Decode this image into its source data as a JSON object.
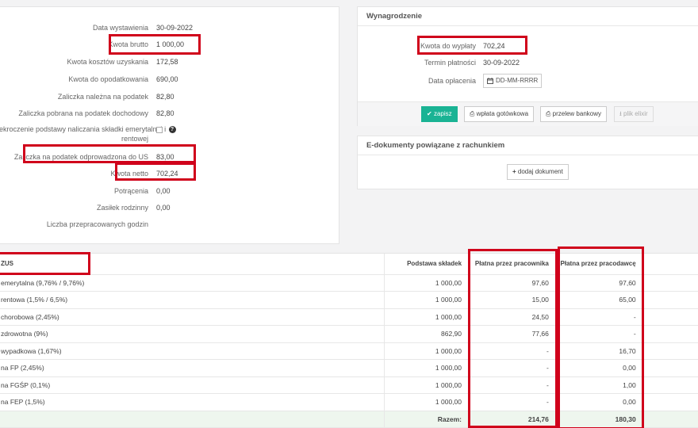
{
  "details": {
    "rows": [
      {
        "label": "Data wystawienia",
        "value": "30-09-2022"
      },
      {
        "label": "Kwota brutto",
        "value": "1 000,00"
      },
      {
        "label": "Kwota kosztów uzyskania",
        "value": "172,58"
      },
      {
        "label": "Kwota do opodatkowania",
        "value": "690,00"
      },
      {
        "label": "Zaliczka należna na podatek",
        "value": "82,80"
      },
      {
        "label": "Zaliczka pobrana na podatek dochodowy",
        "value": "82,80"
      },
      {
        "label": "Zaliczka na podatek odprowadzona do US",
        "value": "83,00"
      },
      {
        "label": "Kwota netto",
        "value": "702,24"
      },
      {
        "label": "Potrącenia",
        "value": "0,00"
      },
      {
        "label": "Zasiłek rodzinny",
        "value": "0,00"
      },
      {
        "label": "Liczba przepracowanych godzin",
        "value": ""
      }
    ],
    "exceed_label_line1": "ekroczenie podstawy naliczania składki emerytalnej i",
    "exceed_label_line2": "rentowej",
    "exceed_help": "?"
  },
  "salary": {
    "title": "Wynagrodzenie",
    "amount_label": "Kwota do wypłaty",
    "amount_value": "702,24",
    "due_label": "Termin płatności",
    "due_value": "30-09-2022",
    "paid_label": "Data opłacenia",
    "paid_placeholder": "DD-MM-RRRR",
    "buttons": {
      "save": "zapisz",
      "cash": "wpłata gotówkowa",
      "transfer": "przelew bankowy",
      "elixir": "plik elixir"
    }
  },
  "edocs": {
    "title": "E-dokumenty powiązane z rachunkiem",
    "add_button": "dodaj dokument"
  },
  "zus": {
    "headers": {
      "name": "ZUS",
      "base": "Podstawa składek",
      "employee": "Płatna przez pracownika",
      "employer": "Płatna przez pracodawcę"
    },
    "rows": [
      {
        "name": "emerytalna (9,76% / 9,76%)",
        "base": "1 000,00",
        "employee": "97,60",
        "employer": "97,60"
      },
      {
        "name": "rentowa (1,5% / 6,5%)",
        "base": "1 000,00",
        "employee": "15,00",
        "employer": "65,00"
      },
      {
        "name": "chorobowa (2,45%)",
        "base": "1 000,00",
        "employee": "24,50",
        "employer": "-"
      },
      {
        "name": "zdrowotna (9%)",
        "base": "862,90",
        "employee": "77,66",
        "employer": "-"
      },
      {
        "name": "wypadkowa (1,67%)",
        "base": "1 000,00",
        "employee": "-",
        "employer": "16,70"
      },
      {
        "name": "na FP (2,45%)",
        "base": "1 000,00",
        "employee": "-",
        "employer": "0,00"
      },
      {
        "name": "na FGŚP (0,1%)",
        "base": "1 000,00",
        "employee": "-",
        "employer": "1,00"
      },
      {
        "name": "na FEP (1,5%)",
        "base": "1 000,00",
        "employee": "-",
        "employer": "0,00"
      }
    ],
    "total_label": "Razem:",
    "total_employee": "214,76",
    "total_employer": "180,30"
  },
  "colors": {
    "highlight": "#d0021b",
    "save_button": "#1ab394"
  }
}
